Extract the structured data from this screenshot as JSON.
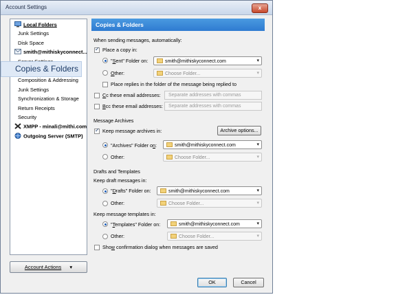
{
  "window": {
    "title": "Account Settings",
    "close_glyph": "x"
  },
  "sidebar": {
    "items": [
      {
        "label": "Local Folders",
        "icon": "local-folders-icon"
      },
      {
        "label": "Junk Settings"
      },
      {
        "label": "Disk Space"
      },
      {
        "label": "smith@mithiskyconnect...",
        "icon": "mail-account-icon"
      },
      {
        "label": "Server Settings"
      },
      {
        "label": "Copies & Folders"
      },
      {
        "label": "Composition & Addressing"
      },
      {
        "label": "Junk Settings"
      },
      {
        "label": "Synchronization & Storage"
      },
      {
        "label": "Return Receipts"
      },
      {
        "label": "Security"
      },
      {
        "label": "XMPP - minali@mithi.com",
        "icon": "xmpp-icon"
      },
      {
        "label": "Outgoing Server (SMTP)",
        "icon": "smtp-icon"
      }
    ],
    "account_actions": "Account Actions",
    "account_actions_arrow": "▾"
  },
  "panel": {
    "title": "Copies & Folders",
    "sending_header": "When sending messages, automatically:",
    "place_copy": "Place a copy in:",
    "sent_folder_pre": "\"",
    "sent_folder_u": "S",
    "sent_folder_post": "ent\" Folder on:",
    "sent_account": "smith@mithiskyconnect.com",
    "other1_u": "O",
    "other1_post": "ther:",
    "choose_folder": "Choose Folder...",
    "place_replies": "Place replies in the folder of the message being replied to",
    "cc_u": "C",
    "cc_post": "c these email addresses:",
    "bcc_u": "B",
    "bcc_post": "cc these email addresses:",
    "sep_placeholder": "Separate addresses with commas",
    "archives_header": "Message Archives",
    "keep_archives": "Keep message archives in:",
    "archive_options": "Archive options...",
    "archives_folder_pre": "\"Archives\" Folder o",
    "archives_folder_u": "n",
    "archives_folder_post": ":",
    "archives_account": "smith@mithiskyconnect.com",
    "other2": "Other:",
    "drafts_header": "Drafts and Templates",
    "keep_drafts": "Keep draft messages in:",
    "drafts_folder_pre": "\"",
    "drafts_folder_u": "D",
    "drafts_folder_post": "rafts\" Folder on:",
    "drafts_account": "smith@mithiskyconnect.com",
    "other3": "Other:",
    "keep_templates": "Keep message templates in:",
    "templates_folder_pre": "\"",
    "templates_folder_u": "T",
    "templates_folder_post": "emplates\" Folder on:",
    "templates_account": "smith@mithiskyconnect.com",
    "other4": "Other:",
    "show_confirm_pre": "Sho",
    "show_confirm_u": "w",
    "show_confirm_post": " confirmation dialog when messages are saved"
  },
  "footer": {
    "ok": "OK",
    "cancel": "Cancel"
  },
  "dropdown_arrow": "▾"
}
